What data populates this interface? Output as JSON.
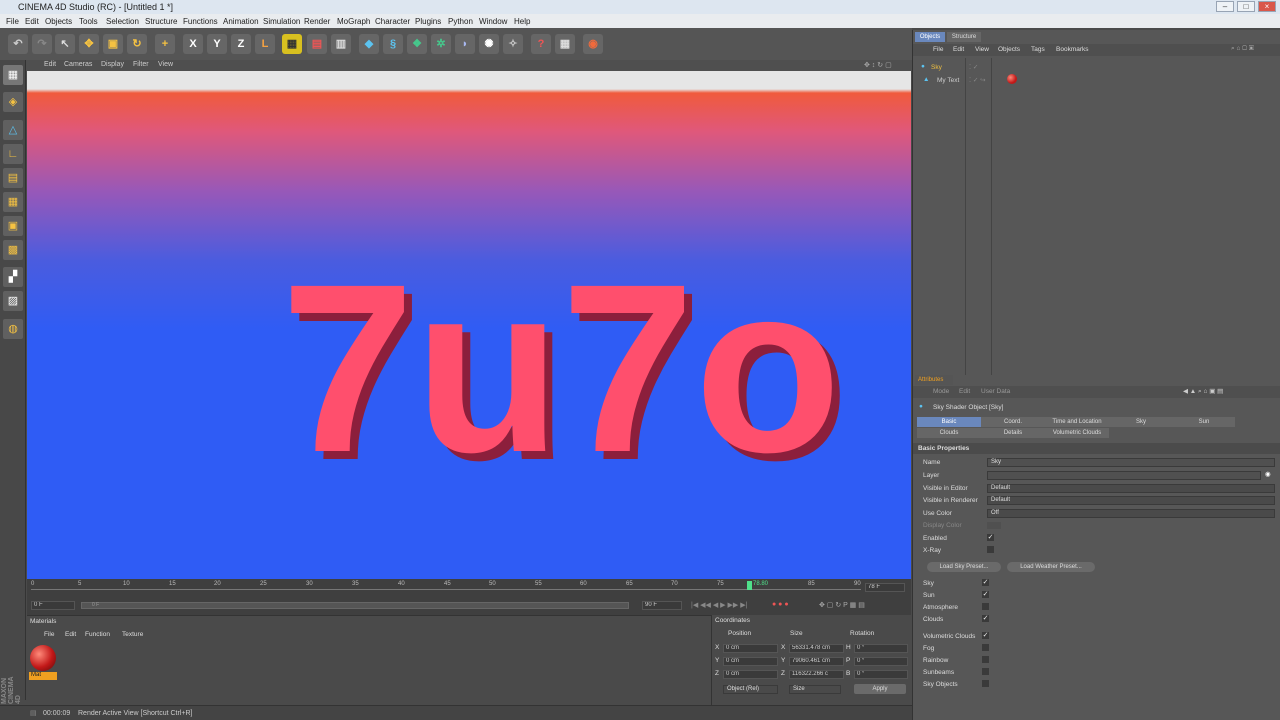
{
  "window": {
    "title": "CINEMA 4D Studio (RC) - [Untitled 1 *]"
  },
  "menu": [
    "File",
    "Edit",
    "Objects",
    "Tools",
    "Selection",
    "Structure",
    "Functions",
    "Animation",
    "Simulation",
    "Render",
    "MoGraph",
    "Character",
    "Plugins",
    "Python",
    "Window",
    "Help"
  ],
  "viewport": {
    "menu": [
      "Edit",
      "Cameras",
      "Display",
      "Filter",
      "View"
    ],
    "scene_text": "7u7o",
    "colors": {
      "sky_top": "#e6e6e6",
      "horizon": "#f05a3c",
      "floor": "#2f5cf5",
      "text": "#ff4f6d"
    }
  },
  "timeline": {
    "ticks": [
      "0",
      "5",
      "10",
      "15",
      "20",
      "25",
      "30",
      "35",
      "40",
      "45",
      "50",
      "55",
      "60",
      "65",
      "70",
      "75",
      "80",
      "85",
      "90"
    ],
    "current_marker": "78.80",
    "current_frame": "78 F",
    "start_field": "0 F",
    "range_start": "0 F",
    "range_end": "90 F"
  },
  "materials": {
    "title": "Materials",
    "menu": [
      "File",
      "Edit",
      "Function",
      "Texture"
    ],
    "items": [
      {
        "name": "Mat"
      }
    ]
  },
  "coordinates": {
    "title": "Coordinates",
    "headers": [
      "Position",
      "Size",
      "Rotation"
    ],
    "rows": [
      {
        "axis": "X",
        "pos": "0 cm",
        "size": "56331.478 cm",
        "rot_label": "H",
        "rot": "0 °"
      },
      {
        "axis": "Y",
        "pos": "0 cm",
        "size": "79060.461 cm",
        "rot_label": "P",
        "rot": "0 °"
      },
      {
        "axis": "Z",
        "pos": "0 cm",
        "size": "116322.266 c",
        "rot_label": "B",
        "rot": "0 °"
      }
    ],
    "mode": "Object (Rel)",
    "size_mode": "Size",
    "apply": "Apply"
  },
  "status": {
    "time": "00:00:09",
    "message": "Render Active View [Shortcut Ctrl+R]"
  },
  "branding": "MAXON CINEMA 4D",
  "objects_panel": {
    "tabs": [
      "Objects",
      "Structure"
    ],
    "menu": [
      "File",
      "Edit",
      "View",
      "Objects",
      "Tags",
      "Bookmarks"
    ],
    "items": [
      {
        "name": "Sky"
      },
      {
        "name": "My Text"
      }
    ]
  },
  "attributes": {
    "tab": "Attributes",
    "menu": [
      "Mode",
      "Edit",
      "User Data"
    ],
    "object_title": "Sky Shader Object [Sky]",
    "tabs_row1": [
      "Basic",
      "Coord.",
      "Time and Location",
      "Sky",
      "Sun"
    ],
    "tabs_row2": [
      "Clouds",
      "Details",
      "Volumetric Clouds"
    ],
    "section": "Basic Properties",
    "props": [
      {
        "label": "Name",
        "value": "Sky"
      },
      {
        "label": "Layer",
        "value": ""
      },
      {
        "label": "Visible in Editor",
        "value": "Default"
      },
      {
        "label": "Visible in Renderer",
        "value": "Default"
      },
      {
        "label": "Use Color",
        "value": "Off"
      },
      {
        "label": "Display Color",
        "value": ""
      },
      {
        "label": "Enabled",
        "value": "✓"
      },
      {
        "label": "X-Ray",
        "value": ""
      }
    ],
    "buttons": [
      "Load Sky Preset...",
      "Load Weather Preset..."
    ],
    "checks1": [
      {
        "label": "Sky",
        "value": "✓"
      },
      {
        "label": "Sun",
        "value": "✓"
      },
      {
        "label": "Atmosphere",
        "value": ""
      },
      {
        "label": "Clouds",
        "value": "✓"
      }
    ],
    "checks2": [
      {
        "label": "Volumetric Clouds",
        "value": "✓"
      },
      {
        "label": "Fog",
        "value": ""
      },
      {
        "label": "Rainbow",
        "value": ""
      },
      {
        "label": "Sunbeams",
        "value": ""
      },
      {
        "label": "Sky Objects",
        "value": ""
      }
    ]
  }
}
